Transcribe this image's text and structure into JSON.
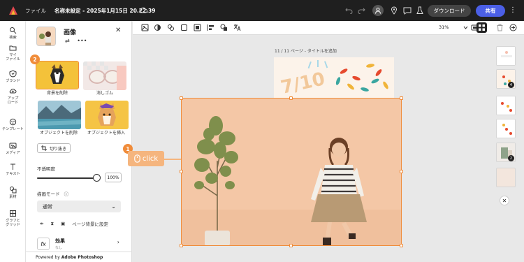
{
  "topbar": {
    "file_label": "ファイル",
    "doc_title": "名称未設定 - 2025年1月15日 20.22.39",
    "download_label": "ダウンロード",
    "share_label": "共有"
  },
  "leftrail": {
    "items": [
      {
        "label": "検索",
        "icon": "search-icon"
      },
      {
        "label": "マイ\nファイル",
        "icon": "folder-icon"
      },
      {
        "label": "ブランド",
        "icon": "brand-icon"
      },
      {
        "label": "アップ\nロード",
        "icon": "upload-icon"
      },
      {
        "label": "テンプレート",
        "icon": "template-icon"
      },
      {
        "label": "メディア",
        "icon": "media-icon"
      },
      {
        "label": "テキスト",
        "icon": "text-icon"
      },
      {
        "label": "素材",
        "icon": "elements-icon"
      },
      {
        "label": "グラフと\nグリッド",
        "icon": "grid-icon"
      }
    ]
  },
  "panel": {
    "title": "画像",
    "actions": [
      {
        "label": "背景を削除"
      },
      {
        "label": "消しゴム"
      },
      {
        "label": "オブジェクトを削除"
      },
      {
        "label": "オブジェクトを挿入"
      }
    ],
    "crop_label": "切り抜き",
    "opacity_label": "不透明度",
    "opacity_value": "100%",
    "opacity": 1.0,
    "blend_label": "描画モード",
    "blend_value": "通常",
    "set_bg_label": "ページ背景に設定",
    "effect_label": "効果",
    "effect_sub": "なし",
    "powered_prefix": "Powered by ",
    "powered_brand": "Adobe Photoshop",
    "step_badge_1": "1",
    "step_badge_2": "2",
    "click_label": "click"
  },
  "toolbar": {
    "zoom": "31%"
  },
  "canvas": {
    "page_label": "11 / 11 ページ - タイトルを追加",
    "bg_text": "7/10"
  },
  "pages": {
    "badge_a": "4",
    "badge_b": "2"
  },
  "colors": {
    "accent": "#f08c3a",
    "share": "#4b5fe6",
    "topbar": "#1f1f1f"
  }
}
